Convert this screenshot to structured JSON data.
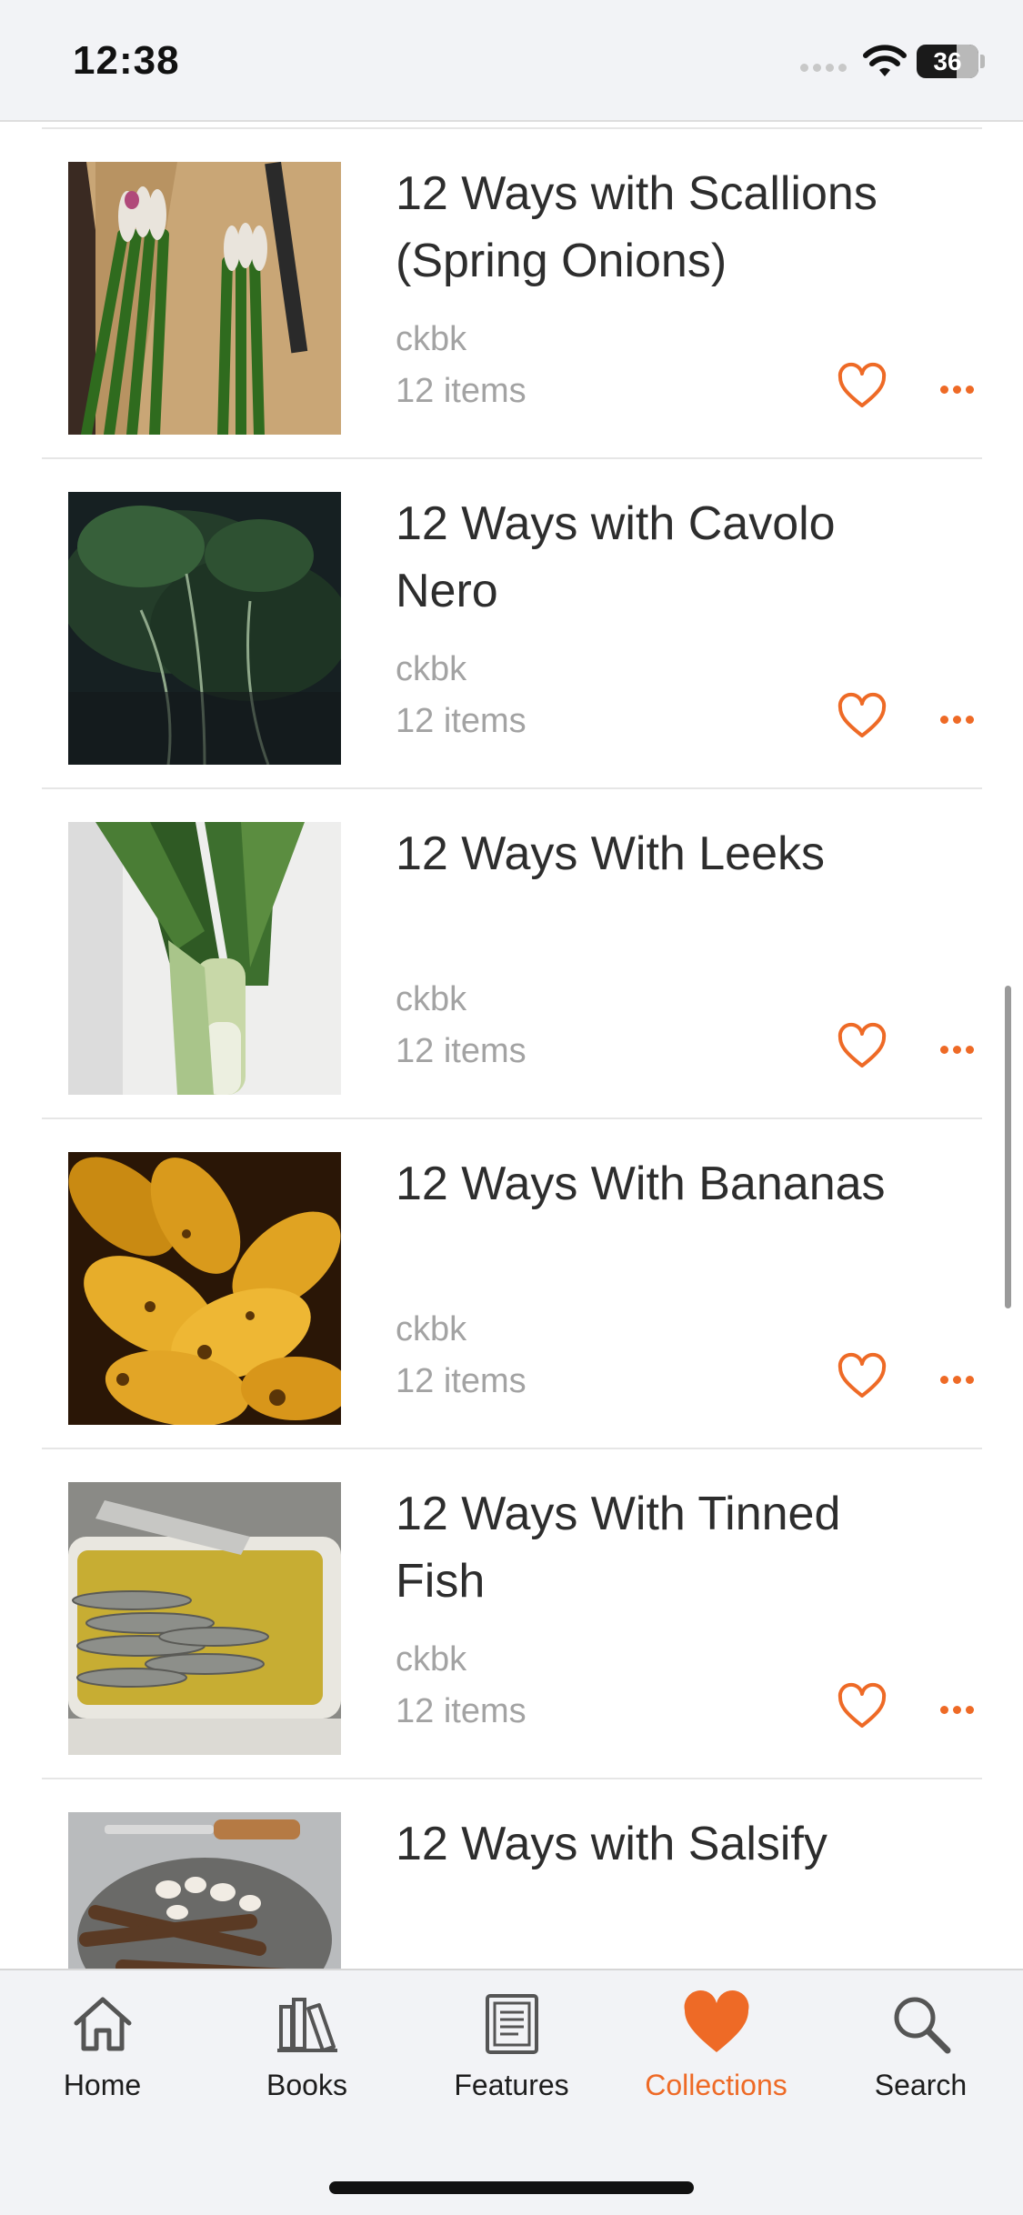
{
  "status_bar": {
    "time": "12:38",
    "battery": "36",
    "battery_level": 0.36
  },
  "colors": {
    "accent": "#ee6a26",
    "text": "#2d2d2d",
    "muted": "#a3a3a3"
  },
  "collections": [
    {
      "title": "12 Ways with Scallions (Spring Onions)",
      "author": "ckbk",
      "count": "12 items"
    },
    {
      "title": "12 Ways with Cavolo Nero",
      "author": "ckbk",
      "count": "12 items"
    },
    {
      "title": "12 Ways With Leeks",
      "author": "ckbk",
      "count": "12 items"
    },
    {
      "title": "12 Ways With Bananas",
      "author": "ckbk",
      "count": "12 items"
    },
    {
      "title": "12 Ways With Tinned Fish",
      "author": "ckbk",
      "count": "12 items"
    },
    {
      "title": "12 Ways with Salsify",
      "author": "",
      "count": ""
    }
  ],
  "tab_bar": {
    "active": "Collections",
    "tabs": [
      {
        "label": "Home",
        "icon": "home-icon"
      },
      {
        "label": "Books",
        "icon": "books-icon"
      },
      {
        "label": "Features",
        "icon": "features-icon"
      },
      {
        "label": "Collections",
        "icon": "heart-icon"
      },
      {
        "label": "Search",
        "icon": "search-icon"
      }
    ]
  }
}
